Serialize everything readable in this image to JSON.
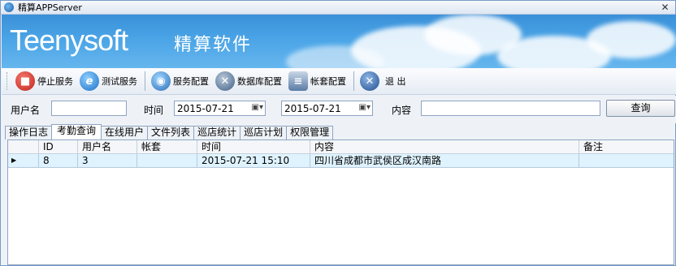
{
  "window": {
    "title": "精算APPServer",
    "close": "✕"
  },
  "banner": {
    "logo": "Teenysoft",
    "logo_cn": "精算软件"
  },
  "toolbar": {
    "items": [
      {
        "label": "停止服务",
        "icon": "stop-service-icon",
        "color": "#d9302b"
      },
      {
        "label": "测试服务",
        "icon": "ie-browser-icon",
        "color": "#2f86d6"
      },
      {
        "label": "服务配置",
        "icon": "globe-config-icon",
        "color": "#3b7fc0"
      },
      {
        "label": "数据库配置",
        "icon": "tools-icon",
        "color": "#4a6f98"
      },
      {
        "label": "帐套配置",
        "icon": "database-icon",
        "color": "#5b7ea6"
      },
      {
        "label": "退 出",
        "icon": "exit-icon",
        "color": "#2c5b9c"
      }
    ]
  },
  "filter": {
    "user_label": "用户名",
    "user_value": "",
    "time_label": "时间",
    "date_from": "2015-07-21",
    "date_to": "2015-07-21",
    "content_label": "内容",
    "content_value": "",
    "search_label": "查询"
  },
  "tabs": [
    "操作日志",
    "考勤查询",
    "在线用户",
    "文件列表",
    "巡店统计",
    "巡店计划",
    "权限管理"
  ],
  "active_tab": "考勤查询",
  "grid": {
    "columns": [
      "",
      "ID",
      "用户名",
      "帐套",
      "时间",
      "内容",
      "备注"
    ],
    "rows": [
      [
        "▶",
        "8",
        "3",
        "",
        "2015-07-21 15:10",
        "四川省成都市武侯区成汉南路",
        ""
      ]
    ]
  }
}
